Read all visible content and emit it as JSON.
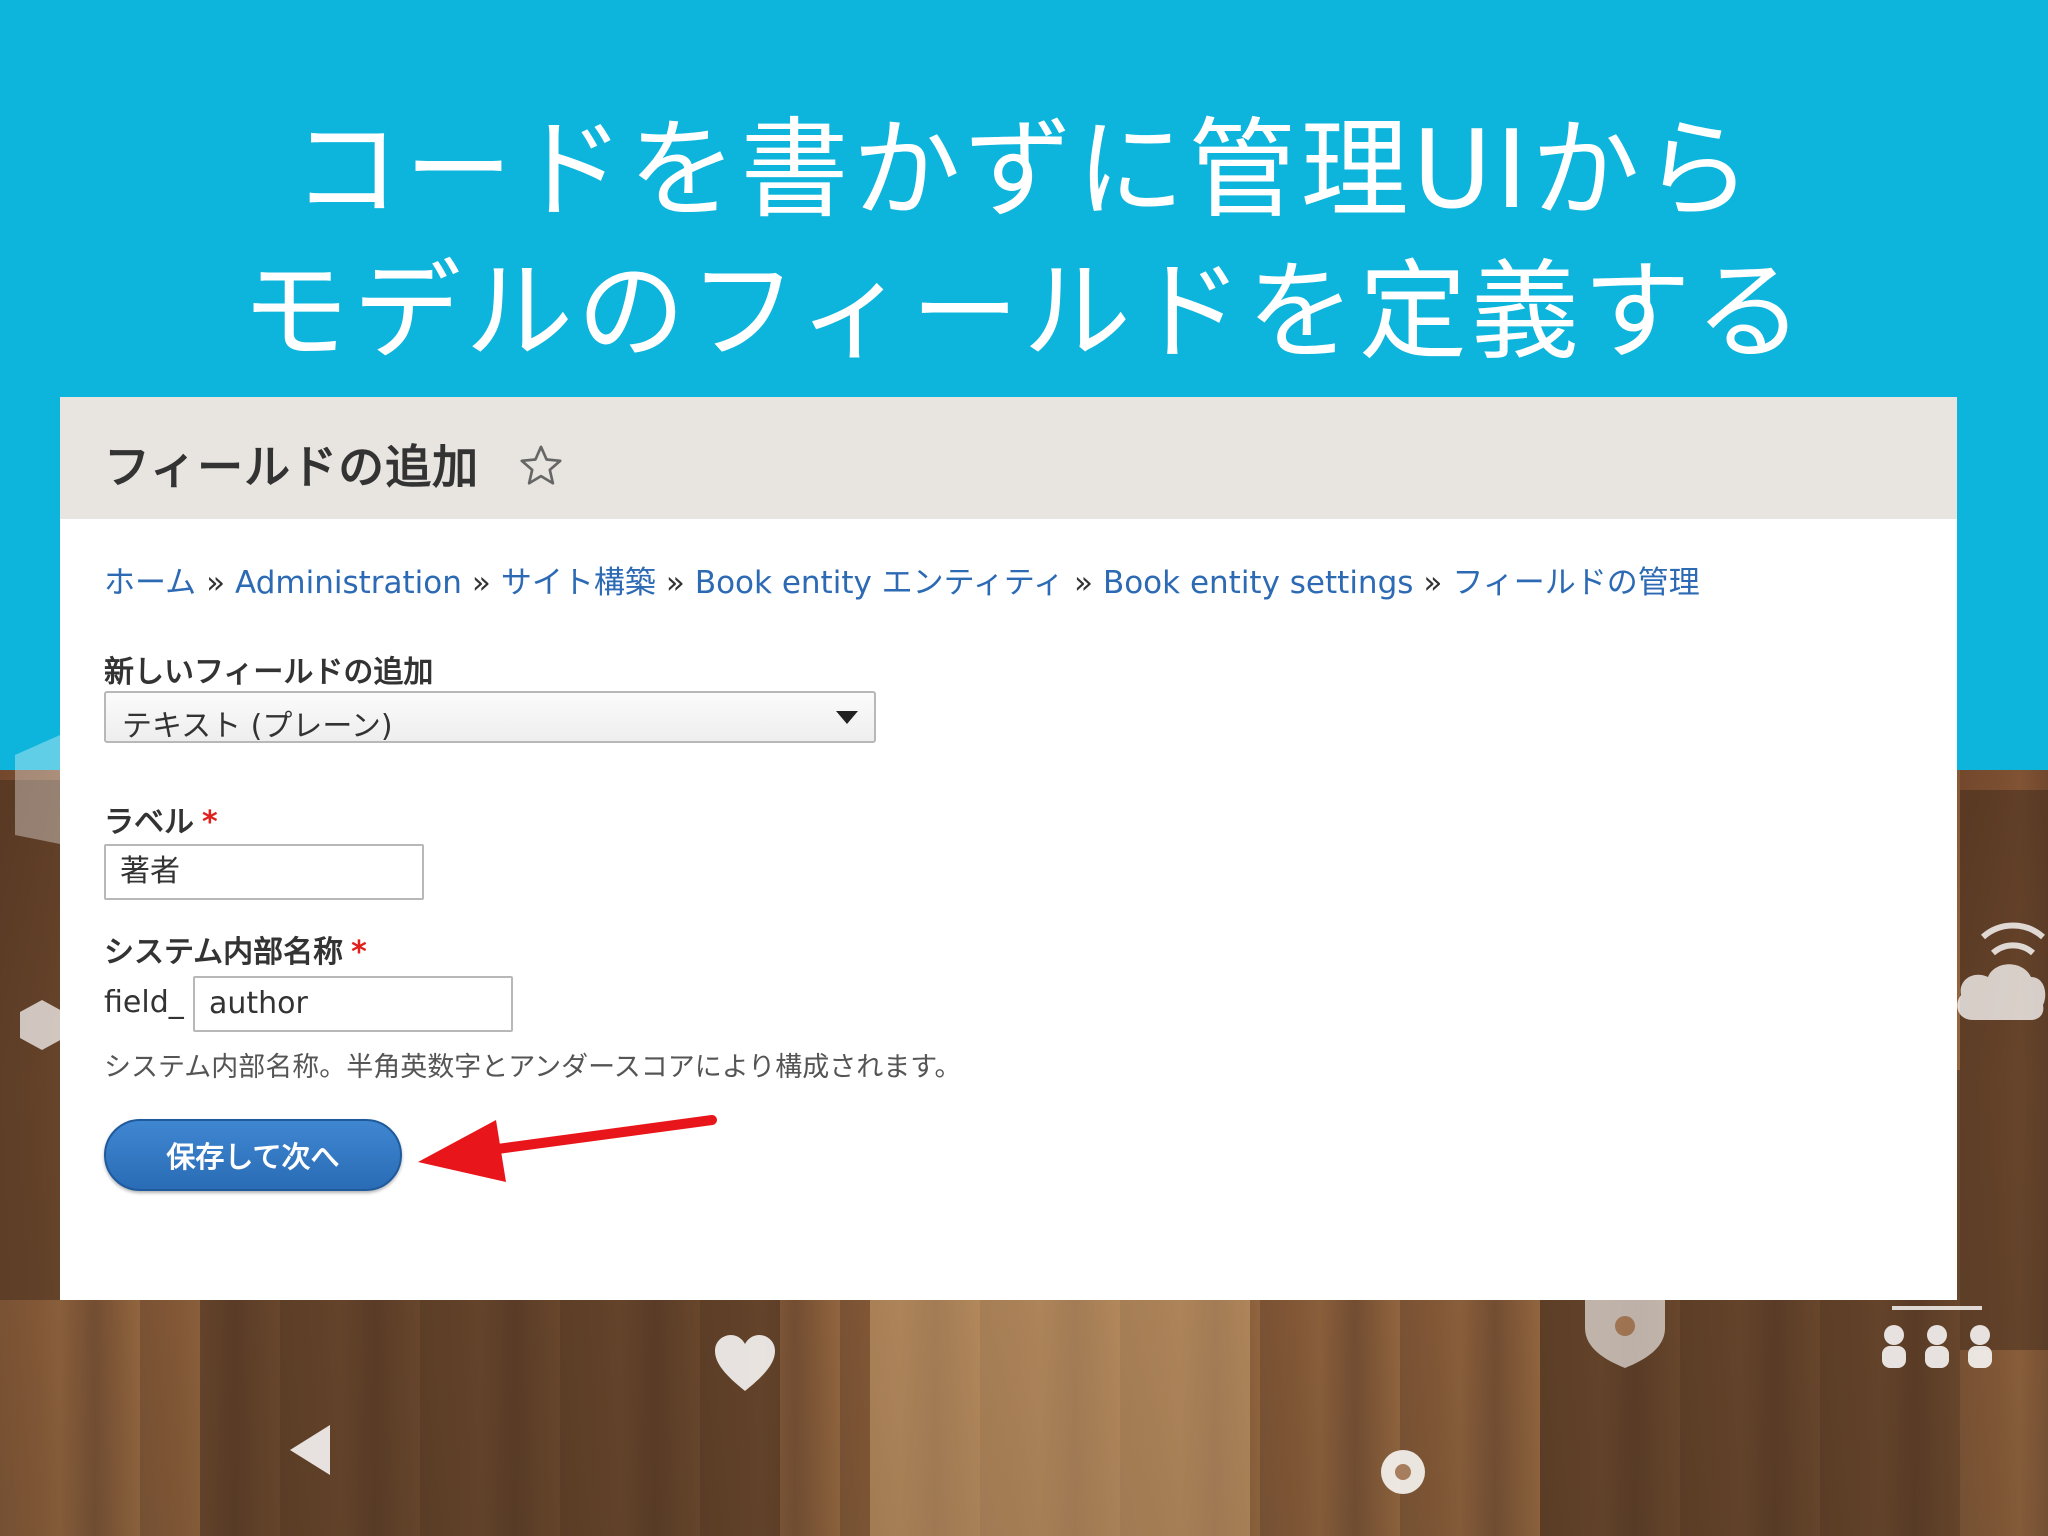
{
  "slide": {
    "title_line1": "コードを書かずに管理UIから",
    "title_line2": "モデルのフィールドを定義する",
    "bg_color": "#0db4dc"
  },
  "page": {
    "title": "フィールドの追加",
    "star_icon": "star-outline-icon"
  },
  "breadcrumb": [
    "ホーム",
    "Administration",
    "サイト構築",
    "Book entity エンティティ",
    "Book entity settings",
    "フィールドの管理"
  ],
  "breadcrumb_sep": "»",
  "form": {
    "new_field_label": "新しいフィールドの追加",
    "new_field_value": "テキスト (プレーン)",
    "label_label": "ラベル",
    "label_value": "著者",
    "machine_name_label": "システム内部名称",
    "machine_name_prefix": "field_",
    "machine_name_value": "author",
    "machine_name_help": "システム内部名称。半角英数字とアンダースコアにより構成されます。",
    "required_mark": "*",
    "submit_label": "保存して次へ"
  },
  "colors": {
    "link": "#2d6ab4",
    "required": "#e0201b",
    "button": "#2a6cb6",
    "arrow": "#e8161b"
  }
}
